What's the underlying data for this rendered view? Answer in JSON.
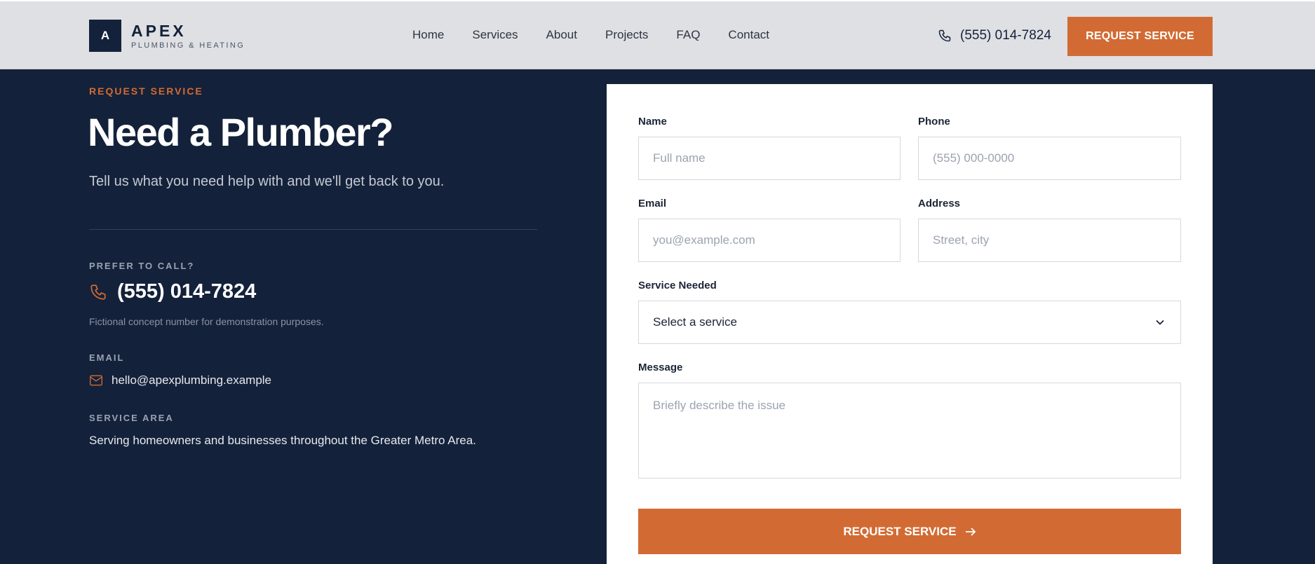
{
  "brand": {
    "mark": "A",
    "name": "APEX",
    "tagline": "PLUMBING & HEATING"
  },
  "nav": [
    "Home",
    "Services",
    "About",
    "Projects",
    "FAQ",
    "Contact"
  ],
  "header": {
    "phone": "(555) 014-7824",
    "cta": "REQUEST SERVICE"
  },
  "hero": {
    "eyebrow": "REQUEST SERVICE",
    "title": "Need a Plumber?",
    "subtitle": "Tell us what you need help with and we'll get back to you."
  },
  "contact": {
    "call_label": "PREFER TO CALL?",
    "phone": "(555) 014-7824",
    "phone_note": "Fictional concept number for demonstration purposes.",
    "email_label": "EMAIL",
    "email": "hello@apexplumbing.example",
    "area_label": "SERVICE AREA",
    "area_text": "Serving homeowners and businesses throughout the Greater Metro Area."
  },
  "form": {
    "name_label": "Name",
    "name_placeholder": "Full name",
    "phone_label": "Phone",
    "phone_placeholder": "(555) 000-0000",
    "email_label": "Email",
    "email_placeholder": "you@example.com",
    "address_label": "Address",
    "address_placeholder": "Street, city",
    "service_label": "Service Needed",
    "service_value": "Select a service",
    "message_label": "Message",
    "message_placeholder": "Briefly describe the issue",
    "submit_label": "REQUEST SERVICE"
  },
  "colors": {
    "navy": "#14213a",
    "accent": "#d26b33",
    "header_bg": "#dfe0e3"
  },
  "icons": {
    "phone": "phone-icon",
    "email": "mail-icon",
    "select": "chevron-down-icon",
    "submit": "arrow-right-icon"
  }
}
